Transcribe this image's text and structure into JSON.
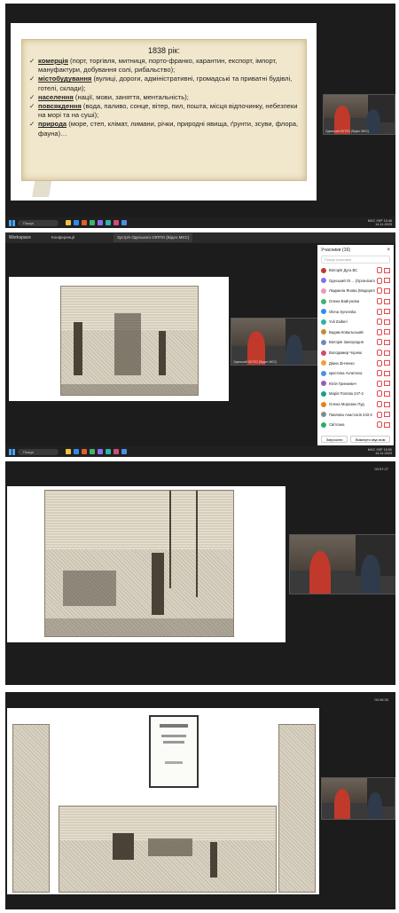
{
  "panel1": {
    "time_badge": "",
    "slide": {
      "year": "1838 рік:",
      "bullets": [
        {
          "term": "комерція",
          "text": " (порт, торгівля,  митниця, порто-франко, карантин, експорт, імпорт, мануфактури, добування солі, рибальство);"
        },
        {
          "term": "містобудування",
          "text": " (вулиці, дороги, адміністративні, громадські та приватні будівлі, готелі, склади);"
        },
        {
          "term": "населення",
          "text": " (нації, мови, заняття, ментальність);"
        },
        {
          "term": "повсякдення",
          "text": " (вода, паливо, сонце, вітер, пил, пошта, місця відпочинку, небезпеки на морі та на суші);"
        },
        {
          "term": "природа",
          "text": " (море, степ, клімат, лимани, річки, природні явища, ґрунти, зсуви, флора, фауна)…"
        }
      ]
    },
    "taskbar": {
      "search": "Пошук",
      "weather": "МЧС",
      "lang": "УКР",
      "time": "15:46",
      "date": "14.11.2023"
    }
  },
  "panel2": {
    "app_title": "Workspace",
    "tabs": [
      "Конференції",
      "Зустріч Одеського ОІППО (Відео МЄС)"
    ],
    "participants": {
      "header": "Учасники (16)",
      "search_placeholder": "Пошук учасника",
      "list": [
        "Вікторія Дуга ВС",
        "Одеський ОІ… (Організатор)",
        "Людмила Янова (Модератор)",
        "Олена Вайгунова",
        "Olena Synevska",
        "Yuli Zaiberi",
        "Вадим Ковальський",
        "Вікторія Завгородня",
        "Володимир Чорнію",
        "Діана Зінченко",
        "кристина Avramova",
        "Юлія Гринкевич",
        "Марія Попова 247-2",
        "Олена Морозюк Пуд",
        "Павлова Анастасія 243-2",
        "Світлана"
      ],
      "invite_button": "Запросити",
      "mute_all_button": "Вимкнути звук всім"
    },
    "taskbar": {
      "search": "Пошук",
      "weather": "МЧС",
      "lang": "УКР",
      "time": "15:50",
      "date": "14.11.2023"
    }
  },
  "panel3": {
    "time_badge": "00:57:27"
  },
  "panel4": {
    "time_badge": "00:46:30"
  },
  "colors": {
    "panel_bg": "#1c1c1c",
    "slide_bg": "#f3ecd9",
    "accent": "#2d8cf0",
    "mic_red": "#e5484d"
  }
}
